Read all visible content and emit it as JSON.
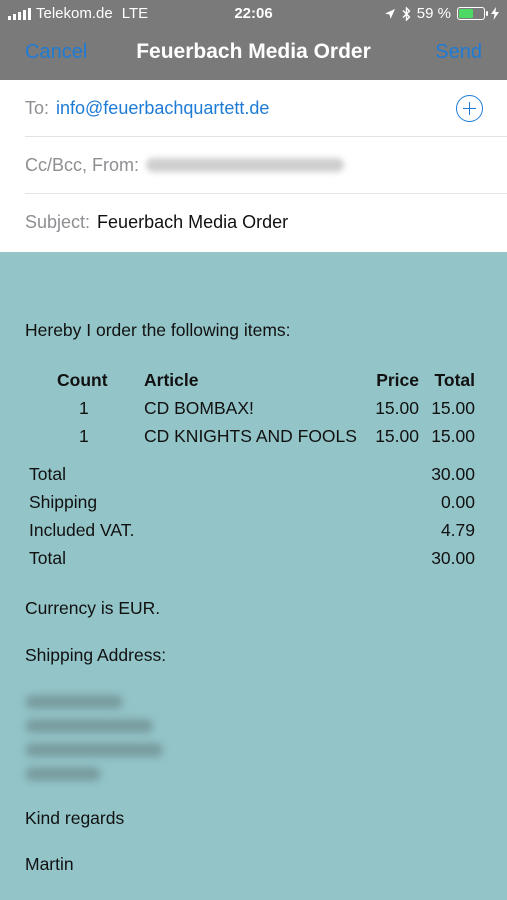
{
  "status_bar": {
    "carrier": "Telekom.de",
    "network": "LTE",
    "time": "22:06",
    "battery": "59 %",
    "battery_level": 0.59
  },
  "nav": {
    "cancel_label": "Cancel",
    "title": "Feuerbach Media Order",
    "send_label": "Send"
  },
  "fields": {
    "to_label": "To:",
    "to_value": "info@feuerbachquartett.de",
    "cc_label": "Cc/Bcc, From:",
    "subject_label": "Subject:",
    "subject_value": "Feuerbach Media Order"
  },
  "body": {
    "intro": "Hereby I order the following items:",
    "table": {
      "headers": {
        "count": "Count",
        "article": "Article",
        "price": "Price",
        "total": "Total"
      },
      "rows": [
        {
          "count": "1",
          "article": "CD BOMBAX!",
          "price": "15.00",
          "total": "15.00"
        },
        {
          "count": "1",
          "article": "CD KNIGHTS AND FOOLS",
          "price": "15.00",
          "total": "15.00"
        }
      ]
    },
    "summary": [
      {
        "label": "Total",
        "value": "30.00"
      },
      {
        "label": "Shipping",
        "value": "0.00"
      },
      {
        "label": "Included VAT.",
        "value": "4.79"
      },
      {
        "label": "Total",
        "value": "30.00"
      }
    ],
    "currency": "Currency is EUR.",
    "shipping_label": "Shipping Address:",
    "regards": "Kind regards",
    "signature": "Martin"
  },
  "colors": {
    "accent": "#1e7bd6",
    "header_bg": "#7a7a7a",
    "body_bg": "#93c4c8"
  }
}
